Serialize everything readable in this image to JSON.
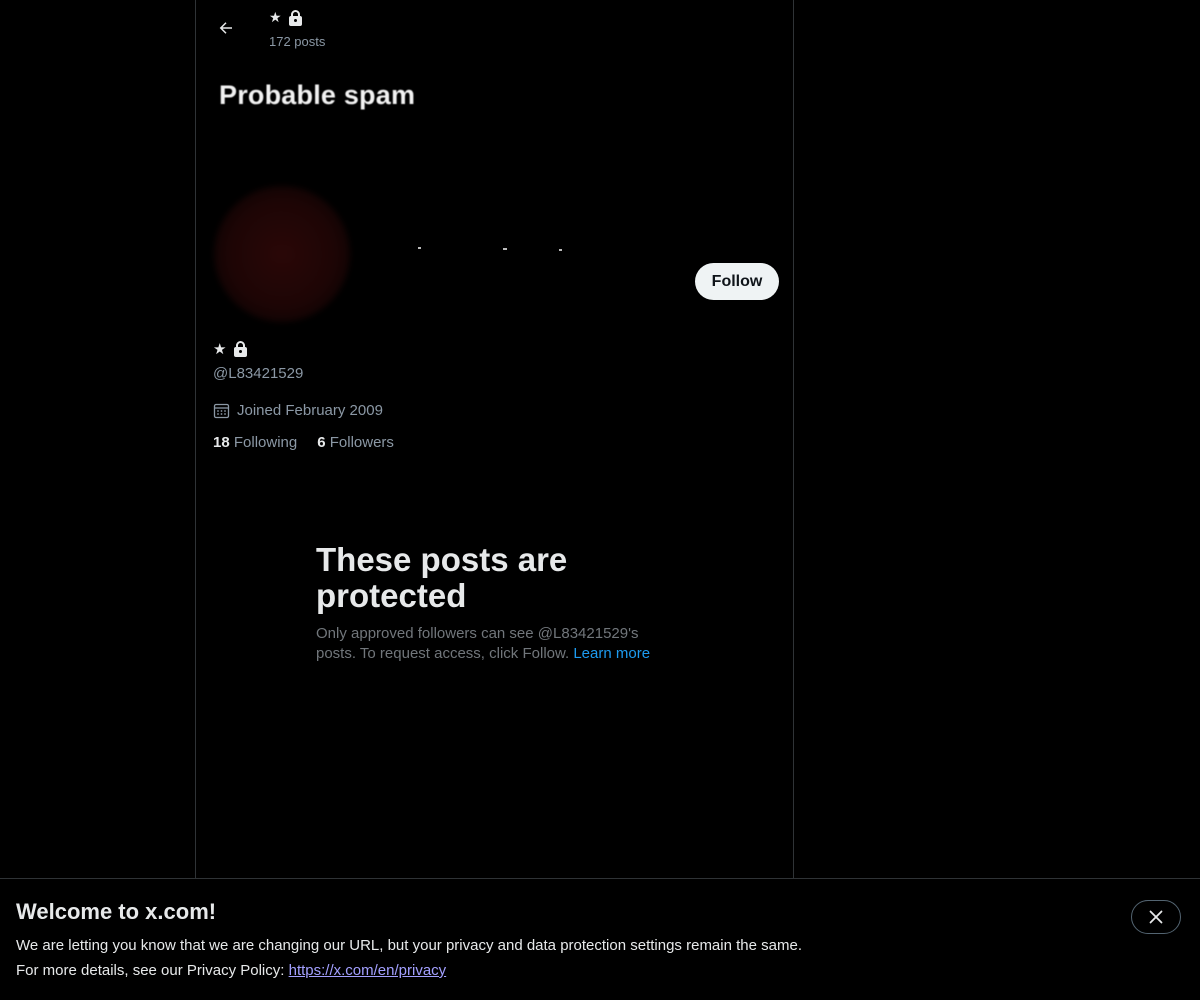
{
  "header": {
    "name_symbol": "★",
    "posts_count": "172 posts"
  },
  "banner": {
    "text": "Probable spam"
  },
  "profile": {
    "name_symbol": "★",
    "handle": "@L83421529",
    "joined": "Joined February 2009",
    "following_count": "18",
    "following_label": "Following",
    "followers_count": "6",
    "followers_label": "Followers",
    "follow_label": "Follow"
  },
  "protected": {
    "title": "These posts are protected",
    "description": "Only approved followers can see @L83421529's posts. To request access, click Follow.",
    "learn_more": "Learn more"
  },
  "cookie_bar": {
    "title": "Welcome to x.com!",
    "line1": "We are letting you know that we are changing our URL, but your privacy and data protection settings remain the same.",
    "line2_prefix": "For more details, see our Privacy Policy:",
    "link": "https://x.com/en/privacy"
  }
}
